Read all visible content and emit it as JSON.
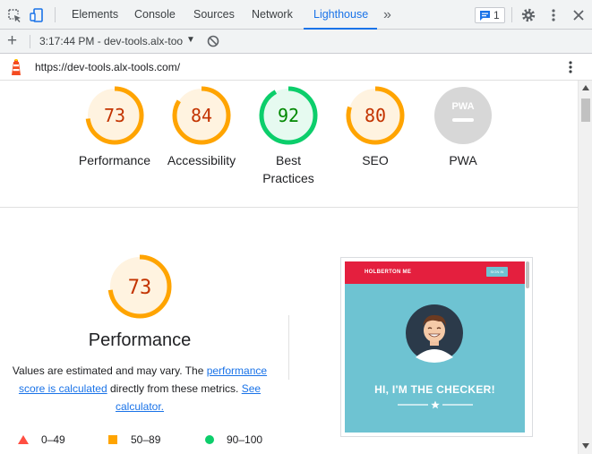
{
  "devtools": {
    "tabs": [
      {
        "label": "Elements"
      },
      {
        "label": "Console"
      },
      {
        "label": "Sources"
      },
      {
        "label": "Network"
      },
      {
        "label": "Lighthouse",
        "active": true
      }
    ],
    "more_tabs_glyph": "»",
    "issues_count": "1"
  },
  "lighthouse_toolbar": {
    "run_label": "3:17:44 PM - dev-tools.alx-too",
    "add_glyph": "+",
    "caret_glyph": "▼"
  },
  "urlbar": {
    "url": "https://dev-tools.alx-tools.com/"
  },
  "scores": [
    {
      "value": "73",
      "fraction": 0.73,
      "label": "Performance",
      "status": "average"
    },
    {
      "value": "84",
      "fraction": 0.84,
      "label": "Accessibility",
      "status": "average"
    },
    {
      "value": "92",
      "fraction": 0.92,
      "label": "Best Practices",
      "status": "pass"
    },
    {
      "value": "80",
      "fraction": 0.8,
      "label": "SEO",
      "status": "average"
    },
    {
      "value": "",
      "label": "PWA",
      "status": "na",
      "badge_text": "PWA"
    }
  ],
  "performance": {
    "score": "73",
    "fraction": 0.73,
    "title": "Performance",
    "desc_prefix": "Values are estimated and may vary. The ",
    "desc_link1": "performance score is calculated",
    "desc_middle": " directly from these metrics. ",
    "desc_link2": "See calculator."
  },
  "legend": [
    {
      "range": "0–49",
      "shape": "triangle"
    },
    {
      "range": "50–89",
      "shape": "square"
    },
    {
      "range": "90–100",
      "shape": "circle"
    }
  ],
  "screenshot": {
    "brand": "HOLBERTON ME",
    "button": "SIGN IN",
    "heading": "HI, I'M THE CHECKER!"
  },
  "colors": {
    "average": "#ffa400",
    "average_text": "#c33300",
    "average_fill": "#fff3e0",
    "pass": "#0cce6b",
    "pass_text": "#008800",
    "pass_fill": "#e6faf0",
    "fail": "#ff4e42",
    "na": "#d7d7d7",
    "accent": "#1a73e8"
  }
}
